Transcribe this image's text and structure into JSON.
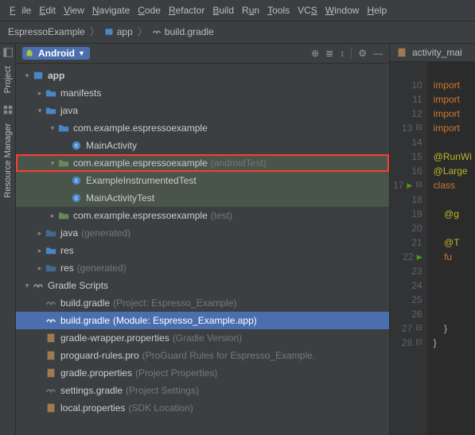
{
  "menu": {
    "file": "File",
    "edit": "Edit",
    "view": "View",
    "navigate": "Navigate",
    "code": "Code",
    "refactor": "Refactor",
    "build": "Build",
    "run": "Run",
    "tools": "Tools",
    "vcs": "VCS",
    "window": "Window",
    "help": "Help"
  },
  "breadcrumb": {
    "project": "EspressoExample",
    "module": "app",
    "file": "build.gradle"
  },
  "left_gutter": {
    "project": "Project",
    "resmgr": "Resource Manager"
  },
  "panel": {
    "mode": "Android",
    "toolbar": {
      "target": "⊕",
      "expand": "≣",
      "sort": "↕",
      "settings": "⚙",
      "hide": "—"
    }
  },
  "tree": {
    "app": "app",
    "manifests": "manifests",
    "java": "java",
    "pkg_main": "com.example.espressoexample",
    "main_activity": "MainActivity",
    "pkg_android_test": "com.example.espressoexample",
    "pkg_android_test_suffix": "(androidTest)",
    "example_instr": "ExampleInstrumentedTest",
    "main_activity_test": "MainActivityTest",
    "pkg_test": "com.example.espressoexample",
    "pkg_test_suffix": "(test)",
    "java_gen": "java",
    "java_gen_suffix": "(generated)",
    "res": "res",
    "res_gen": "res",
    "res_gen_suffix": "(generated)",
    "gradle_scripts": "Gradle Scripts",
    "bg_project": "build.gradle",
    "bg_project_suffix": "(Project: Espresso_Example)",
    "bg_module": "build.gradle",
    "bg_module_suffix": "(Module: Espresso_Example.app)",
    "gw_props": "gradle-wrapper.properties",
    "gw_props_suffix": "(Gradle Version)",
    "proguard": "proguard-rules.pro",
    "proguard_suffix": "(ProGuard Rules for Espresso_Example.",
    "gradle_props": "gradle.properties",
    "gradle_props_suffix": "(Project Properties)",
    "settings_gradle": "settings.gradle",
    "settings_gradle_suffix": "(Project Settings)",
    "local_props": "local.properties",
    "local_props_suffix": "(SDK Location)"
  },
  "editor": {
    "tab_name": "activity_mai",
    "lines": {
      "l10": "import",
      "l11": "import",
      "l12": "import",
      "l13": "import",
      "l15": "@RunWi",
      "l16": "@Large",
      "l17": "class ",
      "l19": "    @g",
      "l21": "    @T",
      "l22": "    fu",
      "l27_brace": "    }",
      "l28_brace": "}",
      "start": 10,
      "end": 28
    }
  }
}
